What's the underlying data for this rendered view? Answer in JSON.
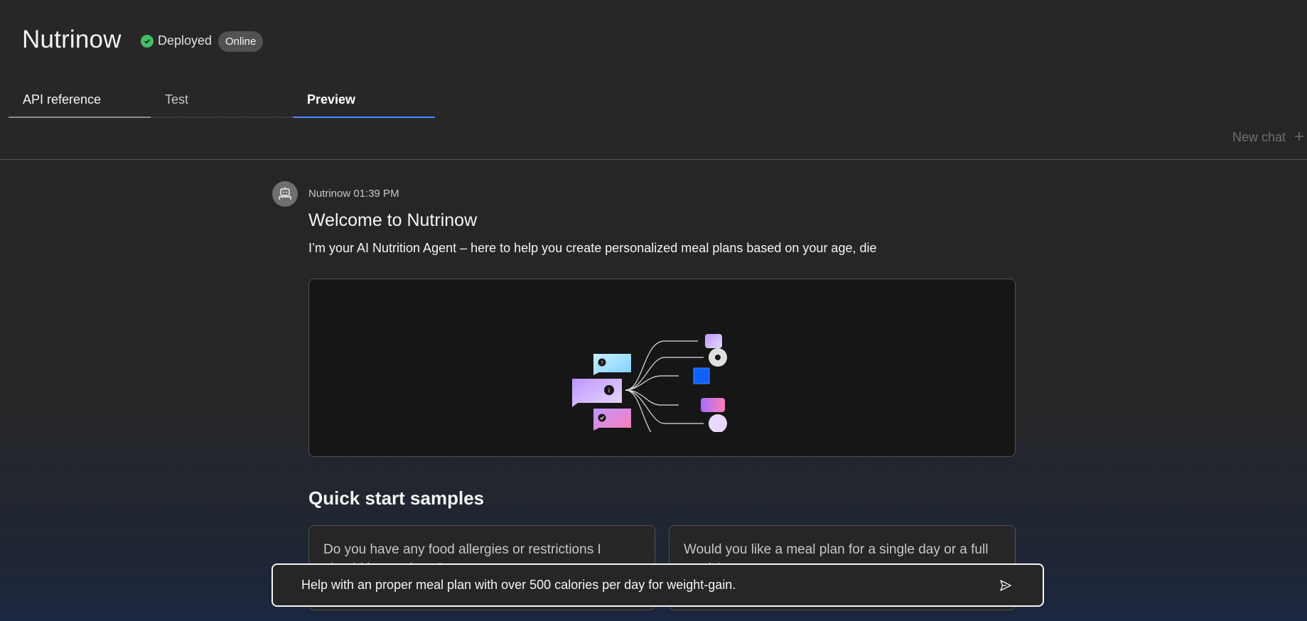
{
  "app": {
    "title": "Nutrinow"
  },
  "status": {
    "label": "Deployed",
    "badge": "Online",
    "status_color": "#42be65"
  },
  "tabs": [
    {
      "label": "API reference"
    },
    {
      "label": "Test"
    },
    {
      "label": "Preview"
    }
  ],
  "new_chat": {
    "label": "New chat",
    "icon": "plus-icon"
  },
  "message": {
    "sender": "Nutrinow",
    "time": "01:39 PM",
    "meta": "Nutrinow 01:39 PM",
    "title": "Welcome to Nutrinow",
    "text": "I’m your AI Nutrition Agent – here to help you create personalized meal plans based on your age, die"
  },
  "quick_start": {
    "title": "Quick start samples",
    "cards": [
      {
        "text": "Do you have any food allergies or restrictions I should know about?"
      },
      {
        "text": "Would you like a meal plan for a single day or a full week?"
      }
    ]
  },
  "input": {
    "value": "Help with an proper meal plan with over 500 calories per day for weight-gain.",
    "send_icon": "send-icon"
  },
  "colors": {
    "accent": "#4589ff",
    "background": "#262626"
  }
}
